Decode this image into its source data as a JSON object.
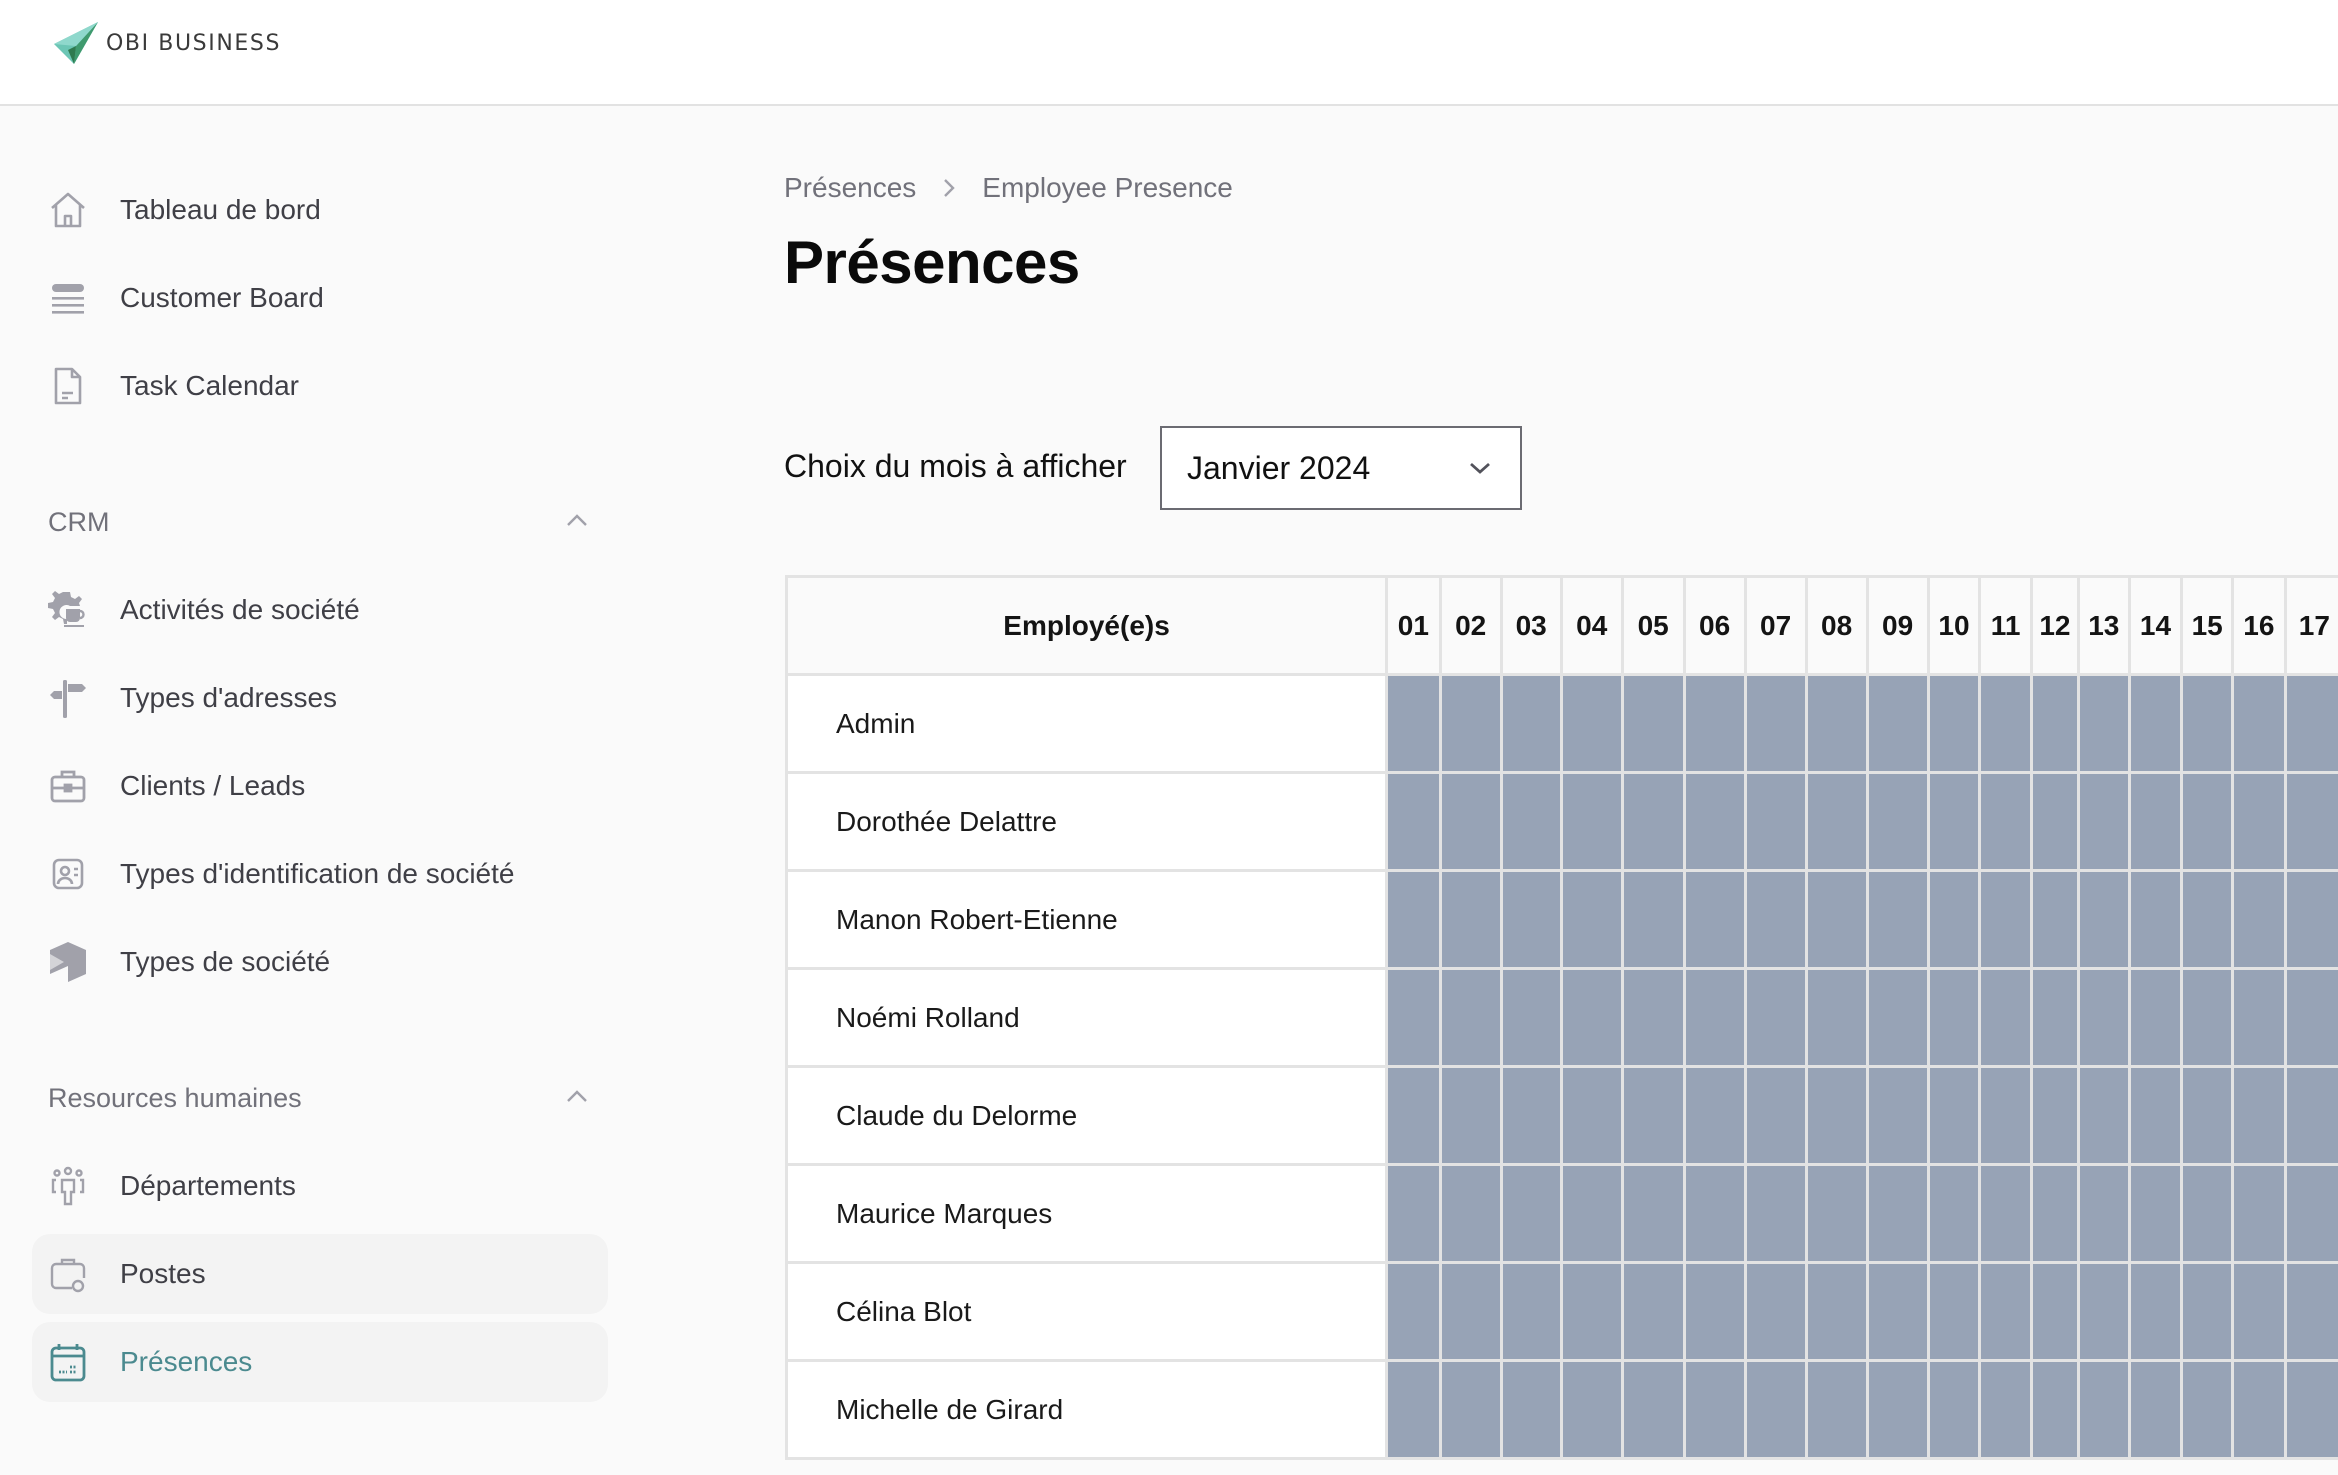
{
  "app": {
    "brand": "OBI BUSINESS"
  },
  "sidebar": {
    "top_items": [
      {
        "label": "Tableau de bord",
        "icon": "home-icon"
      },
      {
        "label": "Customer Board",
        "icon": "list-icon"
      },
      {
        "label": "Task Calendar",
        "icon": "document-icon"
      }
    ],
    "sections": [
      {
        "title": "CRM",
        "expanded": true,
        "items": [
          {
            "label": "Activités de société",
            "icon": "gear-coffee-icon"
          },
          {
            "label": "Types d'adresses",
            "icon": "signpost-icon"
          },
          {
            "label": "Clients / Leads",
            "icon": "briefcase-icon"
          },
          {
            "label": "Types d'identification de société",
            "icon": "id-card-icon"
          },
          {
            "label": "Types de société",
            "icon": "company-type-icon"
          }
        ]
      },
      {
        "title": "Resources humaines",
        "expanded": true,
        "items": [
          {
            "label": "Départements",
            "icon": "people-group-icon"
          },
          {
            "label": "Postes",
            "icon": "briefcase-gear-icon"
          },
          {
            "label": "Présences",
            "icon": "calendar-icon",
            "active": true
          }
        ]
      }
    ]
  },
  "breadcrumb": [
    "Présences",
    "Employee Presence"
  ],
  "page": {
    "title": "Présences"
  },
  "month_picker": {
    "label": "Choix du mois à afficher",
    "value": "Janvier 2024"
  },
  "table": {
    "name_header": "Employé(e)s",
    "days": [
      "01",
      "02",
      "03",
      "04",
      "05",
      "06",
      "07",
      "08",
      "09",
      "10",
      "11",
      "12",
      "13",
      "14",
      "15",
      "16",
      "17"
    ],
    "employees": [
      "Admin",
      "Dorothée Delattre",
      "Manon Robert-Etienne",
      "Noémi Rolland",
      "Claude du Delorme",
      "Maurice Marques",
      "Célina Blot",
      "Michelle de Girard"
    ]
  },
  "colors": {
    "accent": "#4b8a8f",
    "cell_fill": "#97a3b6",
    "border": "#e3e3e3"
  }
}
